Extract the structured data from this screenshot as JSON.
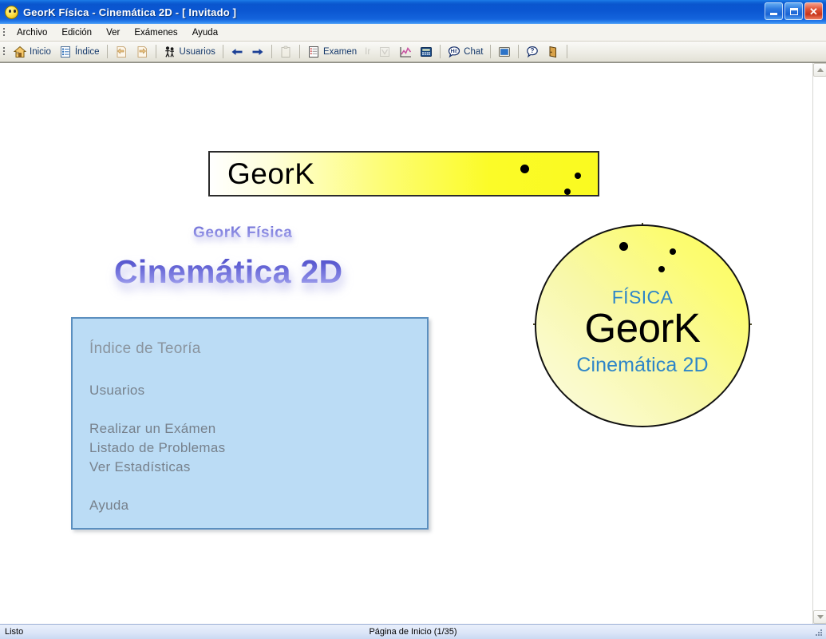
{
  "window": {
    "title": "GeorK Física - Cinemática 2D - [ Invitado ]",
    "icon": "smiley-face-icon",
    "minimize_label": "Minimizar",
    "maximize_label": "Maximizar",
    "close_label": "Cerrar"
  },
  "menubar": {
    "items": [
      {
        "label": "Archivo",
        "name": "menu-archivo"
      },
      {
        "label": "Edición",
        "name": "menu-edicion"
      },
      {
        "label": "Ver",
        "name": "menu-ver"
      },
      {
        "label": "Exámenes",
        "name": "menu-examenes"
      },
      {
        "label": "Ayuda",
        "name": "menu-ayuda"
      }
    ]
  },
  "toolbar": {
    "items": [
      {
        "label": "Inicio",
        "icon": "home-icon",
        "enabled": true
      },
      {
        "label": "Índice",
        "icon": "index-list-icon",
        "enabled": true
      },
      {
        "label": "",
        "icon": "page-back-icon",
        "enabled": true
      },
      {
        "label": "",
        "icon": "page-forward-icon",
        "enabled": true
      },
      {
        "label": "Usuarios",
        "icon": "users-icon",
        "enabled": true
      },
      {
        "label": "",
        "icon": "arrow-left-icon",
        "enabled": true
      },
      {
        "label": "",
        "icon": "arrow-right-icon",
        "enabled": true
      },
      {
        "label": "",
        "icon": "clipboard-icon",
        "enabled": false
      },
      {
        "label": "Examen",
        "icon": "exam-checklist-icon",
        "enabled": true
      },
      {
        "label": "Ir",
        "icon": "",
        "enabled": false
      },
      {
        "label": "",
        "icon": "dropdown-chart-icon",
        "enabled": false
      },
      {
        "label": "",
        "icon": "line-chart-icon",
        "enabled": true
      },
      {
        "label": "",
        "icon": "calculator-icon",
        "enabled": true
      },
      {
        "label": "Chat",
        "icon": "chat-balloon-icon",
        "enabled": true
      },
      {
        "label": "",
        "icon": "screen-icon",
        "enabled": true
      },
      {
        "label": "",
        "icon": "help-question-icon",
        "enabled": true
      },
      {
        "label": "",
        "icon": "exit-door-icon",
        "enabled": true
      }
    ]
  },
  "page": {
    "banner_text": "GeorK",
    "subtitle": "GeorK Física",
    "main_title": "Cinemática 2D",
    "menu_panel": {
      "heading": "Índice de Teoría",
      "items": [
        "Usuarios",
        "Realizar un Exámen",
        "Listado de Problemas",
        "Ver Estadísticas",
        "Ayuda"
      ]
    },
    "logo": {
      "top_text": "FÍSICA",
      "brand_text": "GeorK",
      "bottom_text": "Cinemática 2D"
    }
  },
  "statusbar": {
    "left": "Listo",
    "center": "Página de Inicio  (1/35)"
  },
  "colors": {
    "titlebar_blue": "#0A55CE",
    "banner_yellow": "#FAFA20",
    "panel_blue": "#BBDCF5",
    "panel_border": "#5B8FBF",
    "logo_text_blue": "#2E86C8",
    "title_purple": "#6E6ED6",
    "toolbar_label": "#15396B"
  }
}
